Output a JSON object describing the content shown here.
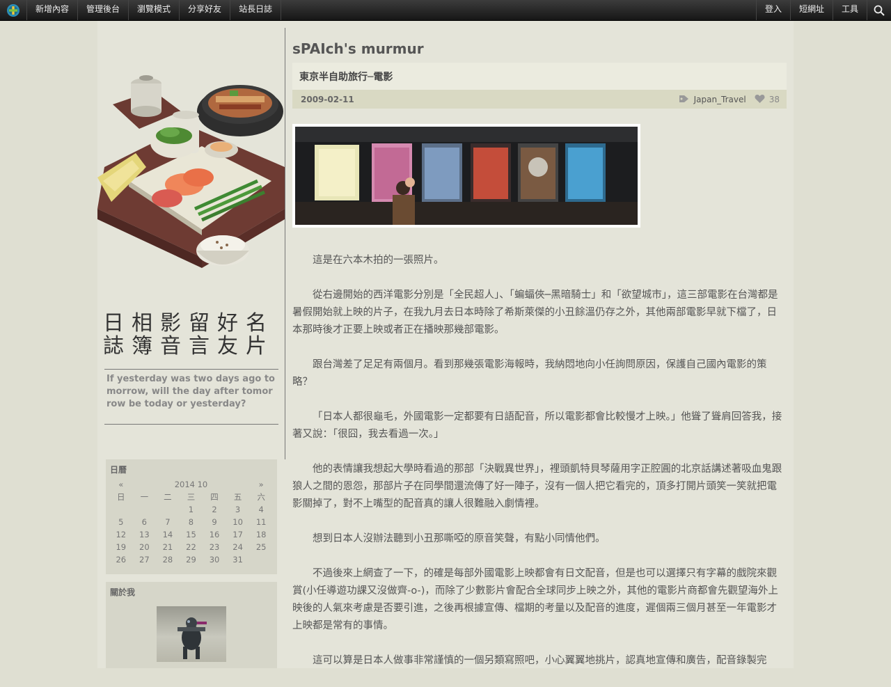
{
  "topbar": {
    "left_items": [
      "新增內容",
      "管理後台",
      "瀏覽模式",
      "分享好友",
      "站長日誌"
    ],
    "right_items": [
      "登入",
      "短網址",
      "工具"
    ],
    "search_icon": "magnifier-icon"
  },
  "sidebar": {
    "title_rows": [
      "日相影留好名",
      "誌簿音言友片"
    ],
    "tagline": "If yesterday was two days ago tomorrow, will the day after tomorrow be today or yesterday?",
    "calendar": {
      "title": "日曆",
      "prev": "«",
      "month_label": "2014 10",
      "next": "»",
      "weekdays": [
        "日",
        "一",
        "二",
        "三",
        "四",
        "五",
        "六"
      ],
      "weeks": [
        [
          "",
          "",
          "",
          "1",
          "2",
          "3",
          "4"
        ],
        [
          "5",
          "6",
          "7",
          "8",
          "9",
          "10",
          "11"
        ],
        [
          "12",
          "13",
          "14",
          "15",
          "16",
          "17",
          "18"
        ],
        [
          "19",
          "20",
          "21",
          "22",
          "23",
          "24",
          "25"
        ],
        [
          "26",
          "27",
          "28",
          "29",
          "30",
          "31",
          ""
        ]
      ]
    },
    "about": {
      "title": "關於我"
    }
  },
  "main": {
    "blog_title": "sPAIch's murmur",
    "post": {
      "title": "東京半自助旅行─電影",
      "date": "2009-02-11",
      "tag": "Japan_Travel",
      "likes": "38",
      "paragraphs": [
        "這是在六本木拍的一張照片。",
        "從右邊開始的西洋電影分別是「全民超人」、「蝙蝠俠─黑暗騎士」和「欲望城市」，這三部電影在台灣都是暑假開始就上映的片子，在我九月去日本時除了希斯萊傑的小丑餘溫仍存之外，其他兩部電影早就下檔了，日本那時後才正要上映或者正在播映那幾部電影。",
        "跟台灣差了足足有兩個月。看到那幾張電影海報時，我納悶地向小任詢問原因，保護自己國內電影的策略？",
        "「日本人都很龜毛，外國電影一定都要有日語配音，所以電影都會比較慢才上映。」他聳了聳肩回答我，接著又說：「很囧，我去看過一次。」",
        "他的表情讓我想起大學時看過的那部「決戰異世界」，裡頭凱特貝琴薩用字正腔圓的北京話講述著吸血鬼跟狼人之間的恩怨，那部片子在同學間還流傳了好一陣子，沒有一個人把它看完的，頂多打開片頭笑一笑就把電影關掉了，對不上嘴型的配音真的讓人很難融入劇情裡。",
        "想到日本人沒辦法聽到小丑那嘶啞的原音笑聲，有點小同情他們。",
        "不過後來上網查了一下，的確是每部外國電影上映都會有日文配音，但是也可以選擇只有字幕的戲院來觀賞(小任導遊功課又沒做齊-o-)，而除了少數影片會配合全球同步上映之外，其他的電影片商都會先觀望海外上映後的人氣來考慮是否要引進，之後再根據宣傳、檔期的考量以及配音的進度，遲個兩三個月甚至一年電影才上映都是常有的事情。",
        "這可以算是日本人做事非常謹慎的一個另類寫照吧，小心翼翼地挑片，認真地宣傳和廣告，配音錄製完"
      ]
    }
  }
}
